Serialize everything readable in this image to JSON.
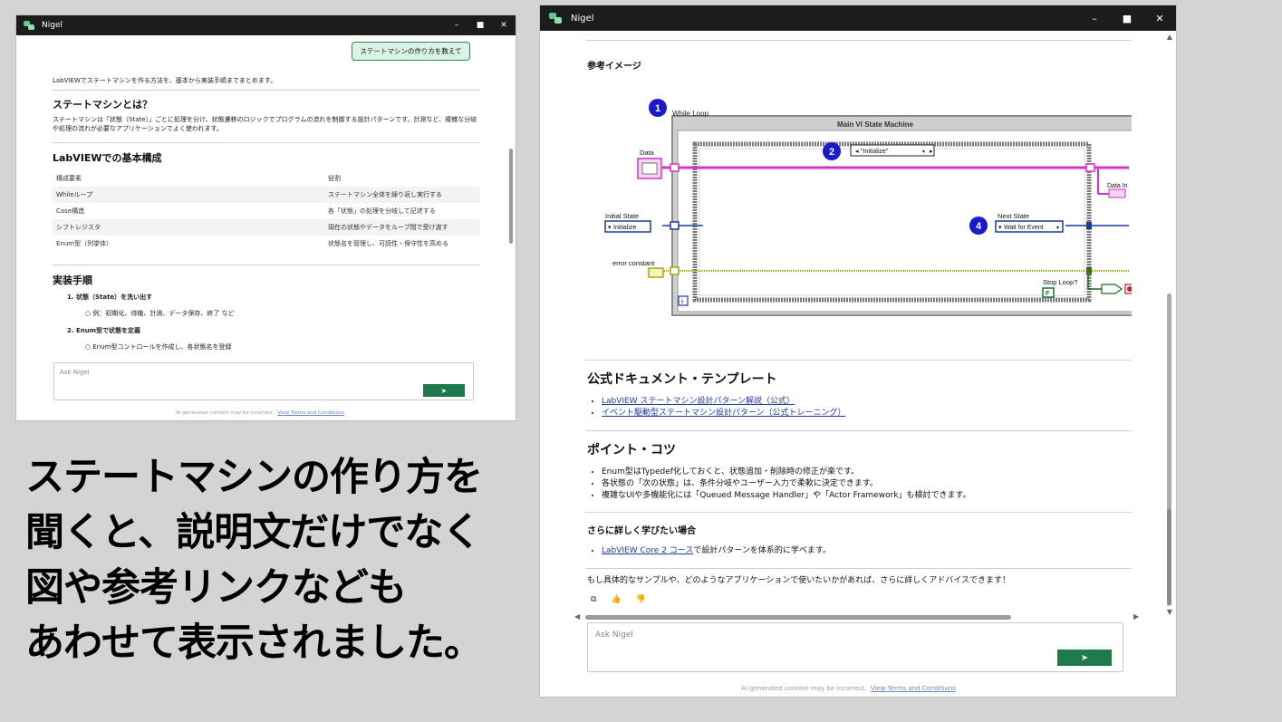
{
  "left_window": {
    "title": "Nigel",
    "controls": {
      "minimize": "–",
      "maximize": "■",
      "close": "✕"
    },
    "user_message": "ステートマシンの作り方を教えて",
    "intro": "LabVIEWでステートマシンを作る方法を、基本から実装手順までまとめます。",
    "section1": {
      "heading": "ステートマシンとは？",
      "text": "ステートマシンは「状態（State）」ごとに処理を分け、状態遷移のロジックでプログラムの流れを制御する設計パターンです。計測など、複雑な分岐や処理の流れが必要なアプリケーションでよく使われます。"
    },
    "section2": {
      "heading": "LabVIEWでの基本構成",
      "table_headers": [
        "構成要素",
        "役割"
      ],
      "rows": [
        [
          "Whileループ",
          "ステートマシン全体を繰り返し実行する"
        ],
        [
          "Case構造",
          "各「状態」の処理を分岐して記述する"
        ],
        [
          "シフトレジスタ",
          "現在の状態やデータをループ間で受け渡す"
        ],
        [
          "Enum型（列挙体）",
          "状態名を管理し、可読性・保守性を高める"
        ]
      ]
    },
    "section3": {
      "heading": "実装手順",
      "step1": "状態（State）を洗い出す",
      "step1_sub": "例：初期化、待機、計測、データ保存、終了 など",
      "step2": "Enum型で状態を定義",
      "step2_sub": "Enum型コントロールを作成し、各状態名を登録"
    },
    "input": {
      "placeholder": "Ask Nigel",
      "send": "➤"
    },
    "footer_text": "AI-generated content may be incorrect.",
    "footer_link": "View Terms and Conditions"
  },
  "right_window": {
    "title": "Nigel",
    "controls": {
      "minimize": "–",
      "maximize": "■",
      "close": "✕"
    },
    "ref_heading": "参考イメージ",
    "diagram": {
      "badge1": "1",
      "badge2": "2",
      "badge4": "4",
      "while_loop": "While Loop",
      "vi_title": "Main VI State Machine",
      "data_label": "Data",
      "initial_state_label": "Initial State",
      "initial_state_value": "Initialize",
      "case_selector": "\"Initialize\"",
      "next_state_label": "Next State",
      "next_state_value": "Wait for Event",
      "error_constant": "error constant",
      "stop_loop": "Stop Loop?",
      "data_in": "Data In",
      "stop_value": "F",
      "iteration": "i"
    },
    "docs": {
      "heading": "公式ドキュメント・テンプレート",
      "link1": "LabVIEW ステートマシン設計パターン解説（公式）",
      "link2": "イベント駆動型ステートマシン設計パターン（公式トレーニング）"
    },
    "tips": {
      "heading": "ポイント・コツ",
      "item1": "Enum型はTypedef化しておくと、状態追加・削除時の修正が楽です。",
      "item2": "各状態の「次の状態」は、条件分岐やユーザー入力で柔軟に決定できます。",
      "item3": "複雑なUIや多機能化には「Queued Message Handler」や「Actor Framework」も検討できます。"
    },
    "learn": {
      "heading": "さらに詳しく学びたい場合",
      "link": "LabVIEW Core 2 コース",
      "link_suffix": "で設計パターンを体系的に学べます。"
    },
    "closing": "もし具体的なサンプルや、どのようなアプリケーションで使いたいかがあれば、さらに詳しくアドバイスできます！",
    "actions": {
      "copy": "⧉",
      "like": "👍",
      "dislike": "👎"
    },
    "input": {
      "placeholder": "Ask Nigel",
      "send": "➤"
    },
    "footer_text": "AI-generated content may be incorrect.",
    "footer_link": "View Terms and Conditions"
  },
  "caption": {
    "line1": "ステートマシンの作り方を",
    "line2": "聞くと、説明文だけでなく",
    "line3": "図や参考リンクなども",
    "line4": "あわせて表示されました。"
  },
  "colors": {
    "titlebar": "#1c1c1c",
    "accent_green": "#1e7a4a",
    "bubble_bg": "#d9f3e4",
    "link_blue": "#1f3e9e",
    "badge_blue": "#1a1acc",
    "wire_pink": "#d631c9",
    "wire_blue": "#1a3c9a",
    "wire_olive": "#a8a800"
  }
}
